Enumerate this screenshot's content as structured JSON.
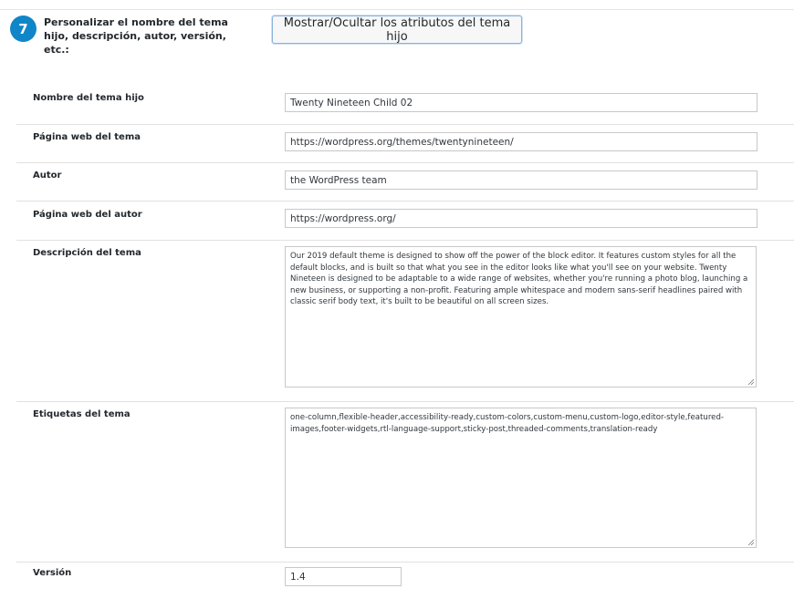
{
  "step": {
    "number": "7",
    "title": "Personalizar el nombre del tema hijo, descripción, autor, versión, etc.:",
    "toggle_label": "Mostrar/Ocultar los atributos del tema hijo"
  },
  "fields": {
    "child_theme_name": {
      "label": "Nombre del tema hijo",
      "value": "Twenty Nineteen Child 02"
    },
    "theme_website": {
      "label": "Página web del tema",
      "value": "https://wordpress.org/themes/twentynineteen/"
    },
    "author": {
      "label": "Autor",
      "value": "the WordPress team"
    },
    "author_website": {
      "label": "Página web del autor",
      "value": "https://wordpress.org/"
    },
    "description": {
      "label": "Descripción del tema",
      "value": "Our 2019 default theme is designed to show off the power of the block editor. It features custom styles for all the default blocks, and is built so that what you see in the editor looks like what you'll see on your website. Twenty Nineteen is designed to be adaptable to a wide range of websites, whether you're running a photo blog, launching a new business, or supporting a non-profit. Featuring ample whitespace and modern sans-serif headlines paired with classic serif body text, it's built to be beautiful on all screen sizes."
    },
    "tags": {
      "label": "Etiquetas del tema",
      "value": "one-column,flexible-header,accessibility-ready,custom-colors,custom-menu,custom-logo,editor-style,featured-images,footer-widgets,rtl-language-support,sticky-post,threaded-comments,translation-ready"
    },
    "version": {
      "label": "Versión",
      "value": "1.4"
    }
  },
  "colors": {
    "accent": "#0f86c8",
    "button_border": "#8ab4dc"
  }
}
